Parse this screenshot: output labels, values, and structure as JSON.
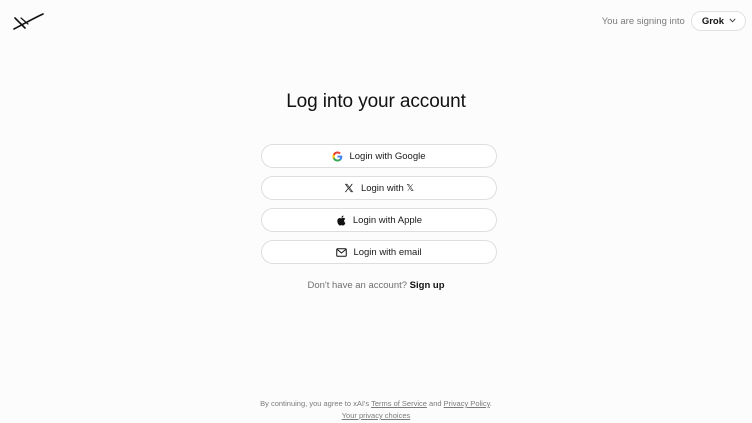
{
  "header": {
    "logo_icon": "xai-logo-icon",
    "signing_into_label": "You are signing into",
    "app_selected": "Grok",
    "app_chevron": "chevron-down-icon"
  },
  "main": {
    "title": "Log into your account",
    "buttons": [
      {
        "icon": "google-icon",
        "label": "Login with Google"
      },
      {
        "icon": "x-logo-icon",
        "label": "Login with 𝕏"
      },
      {
        "icon": "apple-icon",
        "label": "Login with Apple"
      },
      {
        "icon": "mail-icon",
        "label": "Login with email"
      }
    ],
    "signup_prompt": "Don't have an account?",
    "signup_link": "Sign up"
  },
  "footer": {
    "prefix": "By continuing, you agree to xAI's",
    "terms_link": "Terms of Service",
    "and": "and",
    "privacy_link": "Privacy Policy",
    "period": ".",
    "privacy_choices_link": "Your privacy choices"
  },
  "colors": {
    "background": "#fcfcfc",
    "text": "#111111",
    "muted": "#7b7b7b",
    "border": "#dedede"
  }
}
